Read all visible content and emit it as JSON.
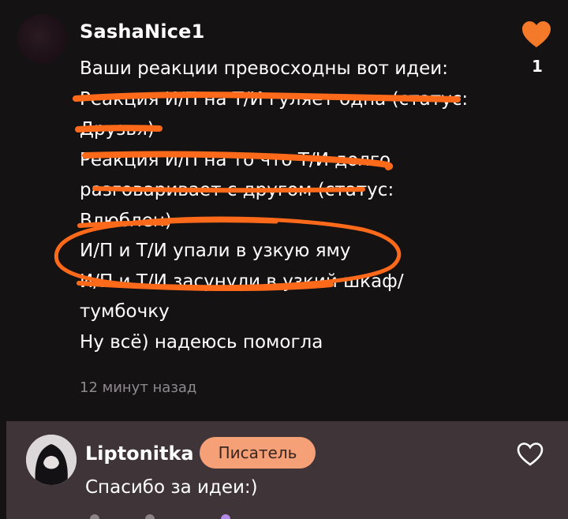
{
  "comment": {
    "username": "SashaNice1",
    "likes": "1",
    "lines": [
      "Ваши реакции превосходны вот идеи:",
      "Реакция И/П на Т/И гуляет одна (статус:",
      "Друзья)",
      "Реакция И/П на то что Т/И долго",
      "разговаривает с другом (статус:",
      "Влюблен)",
      "И/П и Т/И упали в узкую яму",
      "И/П и Т/И засунули в узкий шкаф/",
      "тумбочку",
      "Ну всё) надеюсь помогла"
    ],
    "timestamp": "12 минут назад"
  },
  "reply": {
    "username": "Liptonitka",
    "badge": "Писатель",
    "text": "Спасибо за идеи:)"
  },
  "colors": {
    "accent": "#f47a2a",
    "background": "#151214",
    "reply_background": "#3f3437",
    "badge": "#f6a078",
    "annotation": "#ff6a1a"
  },
  "icons": {
    "like": "heart-icon",
    "reply_like": "heart-outline-icon"
  }
}
